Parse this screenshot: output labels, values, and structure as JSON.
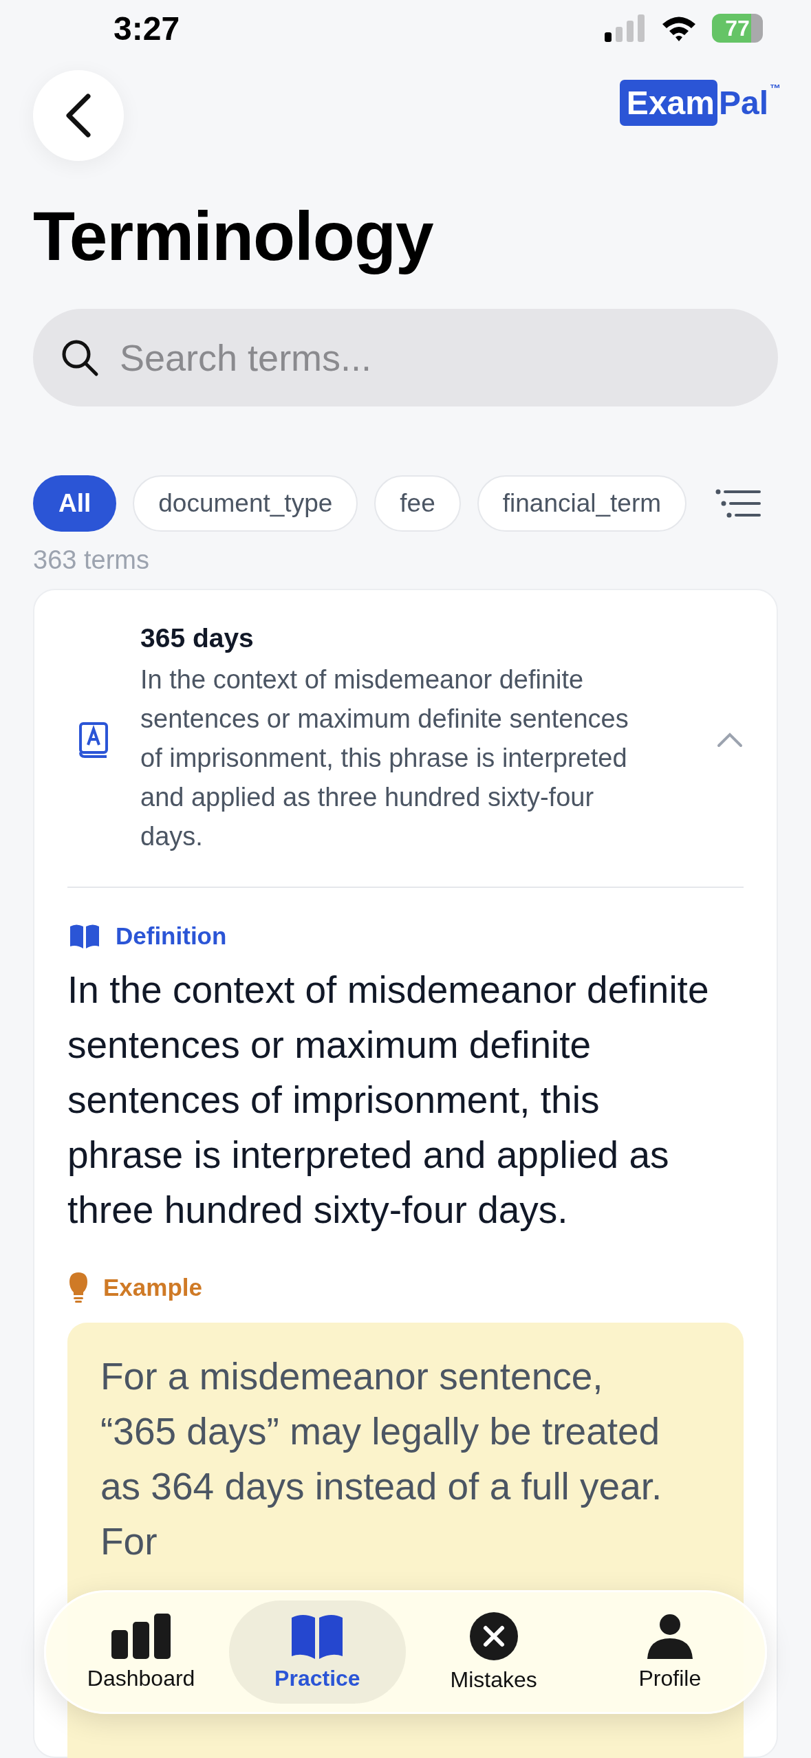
{
  "status_bar": {
    "time": "3:27",
    "battery": "77"
  },
  "logo": {
    "boxed": "Exam",
    "rest": "Pal",
    "mark": "™"
  },
  "title": "Terminology",
  "search": {
    "placeholder": "Search terms..."
  },
  "filters": [
    {
      "label": "All",
      "selected": true
    },
    {
      "label": "document_type",
      "selected": false
    },
    {
      "label": "fee",
      "selected": false
    },
    {
      "label": "financial_term",
      "selected": false
    }
  ],
  "count": "363 terms",
  "term": {
    "name": "365 days",
    "summary": "In the context of misdemeanor definite sentences or maximum definite sentences of imprisonment, this phrase is interpreted and applied as three hundred sixty-four days.",
    "expanded": true,
    "definition_label": "Definition",
    "definition": "In the context of misdemeanor definite sentences or maximum definite sentences of imprisonment, this phrase is interpreted and applied as three hundred sixty-four days.",
    "example_label": "Example",
    "example": "For a misdemeanor sentence, “365 days” may legally be treated as 364 days instead of a full year. For"
  },
  "tab_bar": [
    {
      "label": "Dashboard",
      "selected": false
    },
    {
      "label": "Practice",
      "selected": true
    },
    {
      "label": "Mistakes",
      "selected": false
    },
    {
      "label": "Profile",
      "selected": false
    }
  ]
}
